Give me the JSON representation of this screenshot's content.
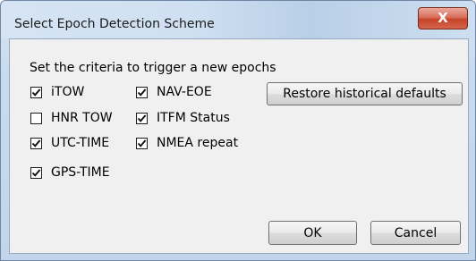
{
  "window": {
    "title": "Select Epoch Detection Scheme",
    "close_label": "X"
  },
  "dialog": {
    "heading": "Set the criteria to trigger a new epochs",
    "checkboxes": [
      {
        "label": "iTOW",
        "checked": true
      },
      {
        "label": "HNR TOW",
        "checked": false
      },
      {
        "label": "UTC-TIME",
        "checked": true
      },
      {
        "label": "GPS-TIME",
        "checked": true
      },
      {
        "label": "NAV-EOE",
        "checked": true
      },
      {
        "label": "ITFM Status",
        "checked": true
      },
      {
        "label": "NMEA repeat",
        "checked": true
      }
    ],
    "restore_button": "Restore historical defaults",
    "ok_button": "OK",
    "cancel_button": "Cancel"
  }
}
